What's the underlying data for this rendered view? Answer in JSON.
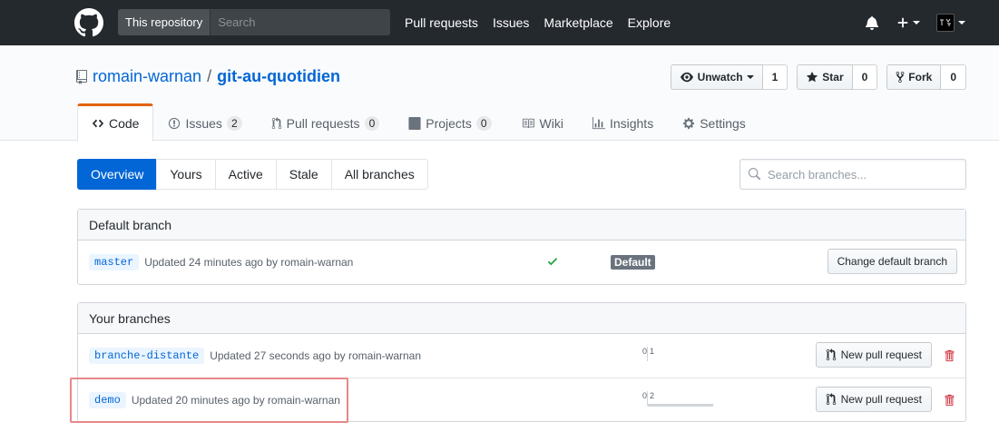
{
  "header": {
    "search_scope": "This repository",
    "search_placeholder": "Search",
    "nav": [
      "Pull requests",
      "Issues",
      "Marketplace",
      "Explore"
    ],
    "icons": [
      "github-logo-icon",
      "bell-icon",
      "plus-icon",
      "avatar"
    ]
  },
  "repo": {
    "owner": "romain-warnan",
    "separator": "/",
    "name": "git-au-quotidien",
    "actions": {
      "watch_label": "Unwatch",
      "watch_count": "1",
      "star_label": "Star",
      "star_count": "0",
      "fork_label": "Fork",
      "fork_count": "0"
    }
  },
  "reponav": {
    "code": "Code",
    "issues": "Issues",
    "issues_count": "2",
    "pulls": "Pull requests",
    "pulls_count": "0",
    "projects": "Projects",
    "projects_count": "0",
    "wiki": "Wiki",
    "insights": "Insights",
    "settings": "Settings"
  },
  "subnav": {
    "items": [
      "Overview",
      "Yours",
      "Active",
      "Stale",
      "All branches"
    ],
    "selected": "Overview",
    "search_placeholder": "Search branches..."
  },
  "default_branch": {
    "header": "Default branch",
    "name": "master",
    "updated": "Updated 24 minutes ago by romain-warnan",
    "label": "Default",
    "button": "Change default branch"
  },
  "your_branches": {
    "header": "Your branches",
    "rows": [
      {
        "name": "branche-distante",
        "updated": "Updated 27 seconds ago by romain-warnan",
        "behind": "0",
        "ahead": "1",
        "ahead_fraction": 0,
        "button": "New pull request"
      },
      {
        "name": "demo",
        "updated": "Updated 20 minutes ago by romain-warnan",
        "behind": "0",
        "ahead": "2",
        "ahead_fraction": 1,
        "button": "New pull request"
      }
    ]
  },
  "colors": {
    "header_bg": "#24292e",
    "link": "#0366d6",
    "selected_tab_border": "#e36209",
    "highlight": "#e8878a",
    "check": "#28a745",
    "trash": "#cb2431"
  }
}
